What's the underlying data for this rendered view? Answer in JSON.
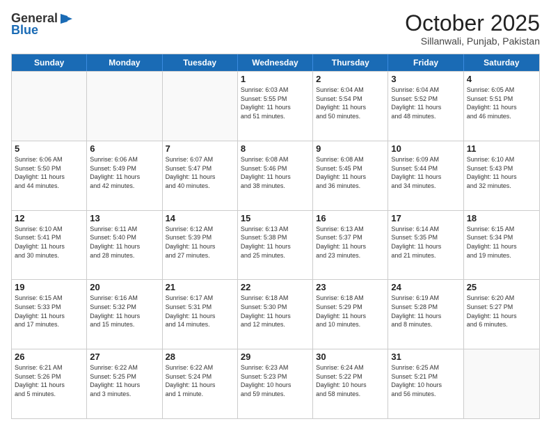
{
  "header": {
    "logo_general": "General",
    "logo_blue": "Blue",
    "month_title": "October 2025",
    "location": "Sillanwali, Punjab, Pakistan"
  },
  "weekdays": [
    "Sunday",
    "Monday",
    "Tuesday",
    "Wednesday",
    "Thursday",
    "Friday",
    "Saturday"
  ],
  "rows": [
    [
      {
        "day": "",
        "info": ""
      },
      {
        "day": "",
        "info": ""
      },
      {
        "day": "",
        "info": ""
      },
      {
        "day": "1",
        "info": "Sunrise: 6:03 AM\nSunset: 5:55 PM\nDaylight: 11 hours\nand 51 minutes."
      },
      {
        "day": "2",
        "info": "Sunrise: 6:04 AM\nSunset: 5:54 PM\nDaylight: 11 hours\nand 50 minutes."
      },
      {
        "day": "3",
        "info": "Sunrise: 6:04 AM\nSunset: 5:52 PM\nDaylight: 11 hours\nand 48 minutes."
      },
      {
        "day": "4",
        "info": "Sunrise: 6:05 AM\nSunset: 5:51 PM\nDaylight: 11 hours\nand 46 minutes."
      }
    ],
    [
      {
        "day": "5",
        "info": "Sunrise: 6:06 AM\nSunset: 5:50 PM\nDaylight: 11 hours\nand 44 minutes."
      },
      {
        "day": "6",
        "info": "Sunrise: 6:06 AM\nSunset: 5:49 PM\nDaylight: 11 hours\nand 42 minutes."
      },
      {
        "day": "7",
        "info": "Sunrise: 6:07 AM\nSunset: 5:47 PM\nDaylight: 11 hours\nand 40 minutes."
      },
      {
        "day": "8",
        "info": "Sunrise: 6:08 AM\nSunset: 5:46 PM\nDaylight: 11 hours\nand 38 minutes."
      },
      {
        "day": "9",
        "info": "Sunrise: 6:08 AM\nSunset: 5:45 PM\nDaylight: 11 hours\nand 36 minutes."
      },
      {
        "day": "10",
        "info": "Sunrise: 6:09 AM\nSunset: 5:44 PM\nDaylight: 11 hours\nand 34 minutes."
      },
      {
        "day": "11",
        "info": "Sunrise: 6:10 AM\nSunset: 5:43 PM\nDaylight: 11 hours\nand 32 minutes."
      }
    ],
    [
      {
        "day": "12",
        "info": "Sunrise: 6:10 AM\nSunset: 5:41 PM\nDaylight: 11 hours\nand 30 minutes."
      },
      {
        "day": "13",
        "info": "Sunrise: 6:11 AM\nSunset: 5:40 PM\nDaylight: 11 hours\nand 28 minutes."
      },
      {
        "day": "14",
        "info": "Sunrise: 6:12 AM\nSunset: 5:39 PM\nDaylight: 11 hours\nand 27 minutes."
      },
      {
        "day": "15",
        "info": "Sunrise: 6:13 AM\nSunset: 5:38 PM\nDaylight: 11 hours\nand 25 minutes."
      },
      {
        "day": "16",
        "info": "Sunrise: 6:13 AM\nSunset: 5:37 PM\nDaylight: 11 hours\nand 23 minutes."
      },
      {
        "day": "17",
        "info": "Sunrise: 6:14 AM\nSunset: 5:35 PM\nDaylight: 11 hours\nand 21 minutes."
      },
      {
        "day": "18",
        "info": "Sunrise: 6:15 AM\nSunset: 5:34 PM\nDaylight: 11 hours\nand 19 minutes."
      }
    ],
    [
      {
        "day": "19",
        "info": "Sunrise: 6:15 AM\nSunset: 5:33 PM\nDaylight: 11 hours\nand 17 minutes."
      },
      {
        "day": "20",
        "info": "Sunrise: 6:16 AM\nSunset: 5:32 PM\nDaylight: 11 hours\nand 15 minutes."
      },
      {
        "day": "21",
        "info": "Sunrise: 6:17 AM\nSunset: 5:31 PM\nDaylight: 11 hours\nand 14 minutes."
      },
      {
        "day": "22",
        "info": "Sunrise: 6:18 AM\nSunset: 5:30 PM\nDaylight: 11 hours\nand 12 minutes."
      },
      {
        "day": "23",
        "info": "Sunrise: 6:18 AM\nSunset: 5:29 PM\nDaylight: 11 hours\nand 10 minutes."
      },
      {
        "day": "24",
        "info": "Sunrise: 6:19 AM\nSunset: 5:28 PM\nDaylight: 11 hours\nand 8 minutes."
      },
      {
        "day": "25",
        "info": "Sunrise: 6:20 AM\nSunset: 5:27 PM\nDaylight: 11 hours\nand 6 minutes."
      }
    ],
    [
      {
        "day": "26",
        "info": "Sunrise: 6:21 AM\nSunset: 5:26 PM\nDaylight: 11 hours\nand 5 minutes."
      },
      {
        "day": "27",
        "info": "Sunrise: 6:22 AM\nSunset: 5:25 PM\nDaylight: 11 hours\nand 3 minutes."
      },
      {
        "day": "28",
        "info": "Sunrise: 6:22 AM\nSunset: 5:24 PM\nDaylight: 11 hours\nand 1 minute."
      },
      {
        "day": "29",
        "info": "Sunrise: 6:23 AM\nSunset: 5:23 PM\nDaylight: 10 hours\nand 59 minutes."
      },
      {
        "day": "30",
        "info": "Sunrise: 6:24 AM\nSunset: 5:22 PM\nDaylight: 10 hours\nand 58 minutes."
      },
      {
        "day": "31",
        "info": "Sunrise: 6:25 AM\nSunset: 5:21 PM\nDaylight: 10 hours\nand 56 minutes."
      },
      {
        "day": "",
        "info": ""
      }
    ]
  ]
}
